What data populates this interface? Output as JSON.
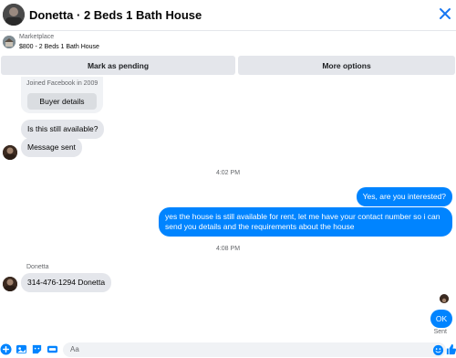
{
  "header": {
    "title": "Donetta · 2 Beds 1 Bath House",
    "avatar_icon": "person-photo",
    "close_icon": "close-icon"
  },
  "listing": {
    "source": "Marketplace",
    "title": "$800 - 2 Beds 1 Bath House",
    "thumb_icon": "house-photo"
  },
  "actions": {
    "pending_label": "Mark as pending",
    "more_label": "More options"
  },
  "profile_card": {
    "joined": "Joined Facebook in 2009",
    "buyer_details_label": "Buyer details"
  },
  "messages": {
    "m1": "Is this still available?",
    "m2": "Message sent",
    "ts1": "4:02 PM",
    "m3": "Yes, are you interested?",
    "m4": "yes the house is still available for rent, let me have your contact number so i can send you details and the requirements about the house",
    "ts2": "4:08 PM",
    "sender": "Donetta",
    "m5": "314-476-1294 Donetta",
    "m6": "OK",
    "sent_status": "Sent"
  },
  "composer": {
    "placeholder": "Aa",
    "icons": [
      "add-icon",
      "image-icon",
      "sticker-icon",
      "gif-icon",
      "emoji-icon",
      "like-icon"
    ]
  },
  "colors": {
    "accent": "#0084ff",
    "incoming_bubble": "#e4e6eb",
    "button_bg": "#e4e6eb"
  }
}
